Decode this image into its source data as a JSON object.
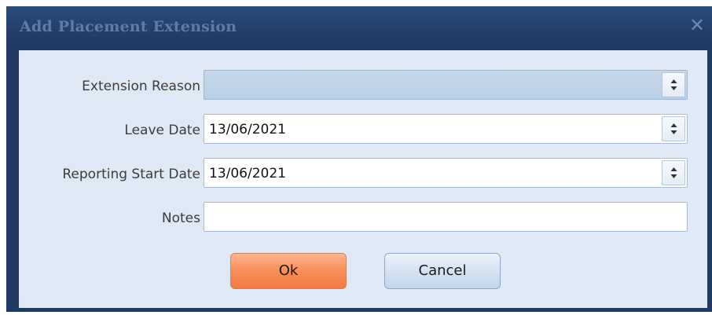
{
  "dialog": {
    "title": "Add Placement Extension",
    "close_glyph": "✕"
  },
  "fields": {
    "extension_reason": {
      "label": "Extension Reason",
      "value": ""
    },
    "leave_date": {
      "label": "Leave Date",
      "value": "13/06/2021"
    },
    "reporting_start_date": {
      "label": "Reporting Start Date",
      "value": "13/06/2021"
    },
    "notes": {
      "label": "Notes",
      "value": ""
    }
  },
  "buttons": {
    "ok_label": "Ok",
    "cancel_label": "Cancel"
  },
  "colors": {
    "title_bar": "#243f6a",
    "client_area": "#dfe8f5",
    "ok_button": "#f98d5a",
    "cancel_button": "#d3e1f1"
  },
  "icons": {
    "close": "close-icon",
    "spin": "spin-updown-icon"
  }
}
